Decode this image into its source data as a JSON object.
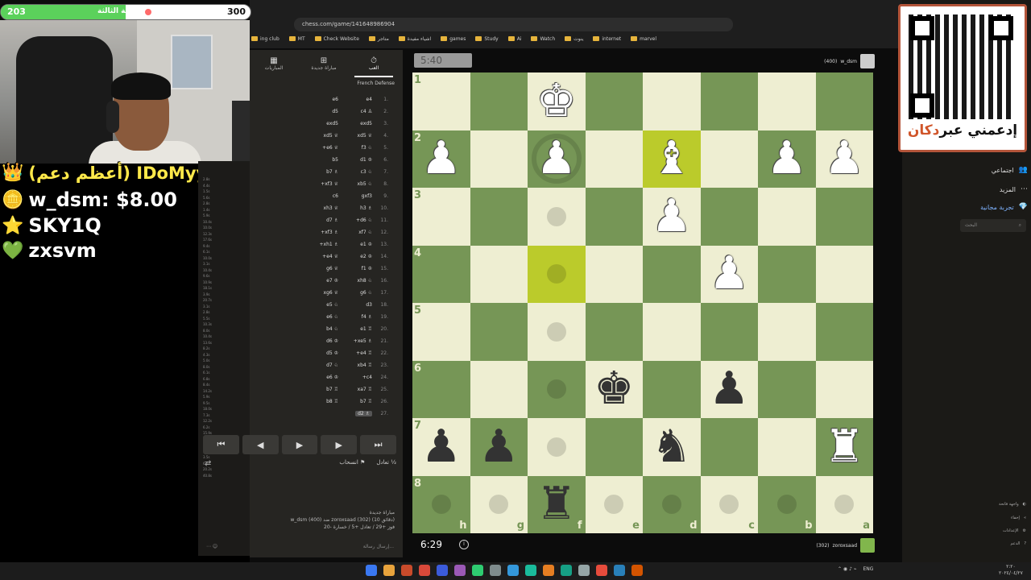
{
  "browser": {
    "url": "chess.com/game/141648986904",
    "bookmarks": [
      "ing club",
      "MT",
      "Check Website",
      "متاجر",
      "اشياء مفيدة",
      "games",
      "Study",
      "Ai",
      "Watch",
      "ينوت",
      "internet",
      "marvel"
    ]
  },
  "overlay": {
    "goal": {
      "start": "203",
      "end": "300",
      "label": "المنوية الثالثة",
      "progress_fraction": 0.5
    },
    "donations": [
      {
        "icon": "crown-icon",
        "glyph": "👑",
        "text": "(أعظم دعم) IDoMyy: $51.00"
      },
      {
        "icon": "coin-icon",
        "glyph": "🪙",
        "text": "w_dsm: $8.00"
      },
      {
        "icon": "star-icon",
        "glyph": "⭐",
        "text": "SKY1Q"
      },
      {
        "icon": "heart-icon",
        "glyph": "💚",
        "text": "zxsvm"
      }
    ]
  },
  "panel": {
    "tabs": [
      {
        "label": "العب",
        "glyph": "⏱"
      },
      {
        "label": "مباراة جديدة",
        "glyph": "⊞"
      },
      {
        "label": "المباريات",
        "glyph": "▦"
      }
    ],
    "opening": "French Defense",
    "moves": [
      {
        "n": "1.",
        "w": "e4",
        "b": "e6"
      },
      {
        "n": "2.",
        "w": "c4 ♙",
        "b": "d5"
      },
      {
        "n": "3.",
        "w": "exd5",
        "b": "exd5"
      },
      {
        "n": "4.",
        "w": "xd5 ♕",
        "b": "xd5 ♕"
      },
      {
        "n": "5.",
        "w": "f3 ♘",
        "b": "+e6 ♕"
      },
      {
        "n": "6.",
        "w": "d1 ♔",
        "b": "b5"
      },
      {
        "n": "7.",
        "w": "c3 ♘",
        "b": "b7 ♗"
      },
      {
        "n": "8.",
        "w": "xb5 ♘",
        "b": "+xf3 ♕"
      },
      {
        "n": "9.",
        "w": "gxf3",
        "b": "c6"
      },
      {
        "n": "10.",
        "w": "h3 ♗",
        "b": "xh3 ♕"
      },
      {
        "n": "11.",
        "w": "+d6 ♘",
        "b": "d7 ♗"
      },
      {
        "n": "12.",
        "w": "xf7 ♘",
        "b": "+xf3 ♗"
      },
      {
        "n": "13.",
        "w": "e1 ♔",
        "b": "+xh1 ♗"
      },
      {
        "n": "14.",
        "w": "e2 ♔",
        "b": "+e4 ♕"
      },
      {
        "n": "15.",
        "w": "f1 ♔",
        "b": "g6 ♕"
      },
      {
        "n": "16.",
        "w": "xh8 ♘",
        "b": "e7 ♔"
      },
      {
        "n": "17.",
        "w": "g6 ♘",
        "b": "xg6 ♕"
      },
      {
        "n": "18.",
        "w": "d3",
        "b": "e5 ♘"
      },
      {
        "n": "19.",
        "w": "f4 ♗",
        "b": "e6 ♘"
      },
      {
        "n": "20.",
        "w": "e1 ♖",
        "b": "b4 ♘"
      },
      {
        "n": "21.",
        "w": "+xe5 ♗",
        "b": "d6 ♔"
      },
      {
        "n": "22.",
        "w": "+e4 ♖",
        "b": "d5 ♔"
      },
      {
        "n": "23.",
        "w": "xb4 ♖",
        "b": "d7 ♘"
      },
      {
        "n": "24.",
        "w": "+c4",
        "b": "e6 ♔"
      },
      {
        "n": "25.",
        "w": "xa7 ♖",
        "b": "b7 ♖"
      },
      {
        "n": "26.",
        "w": "b7 ♖",
        "b": "b8 ♖"
      },
      {
        "n": "27.",
        "w": "d2 ♗",
        "b": ""
      }
    ],
    "move_times": [
      "2.8s",
      "4.4s",
      "1.5s",
      "5.6s",
      "2.8s",
      "1.4s",
      "5.9s",
      "10.4s",
      "10.0s",
      "12.3s",
      "17.6s",
      "9.4s",
      "6.1s",
      "10.0s",
      "3.1s",
      "10.4s",
      "9.6s",
      "10.9s",
      "18.1s",
      "3.9s",
      "20.7s",
      "3.1s",
      "2.8s",
      "5.5s",
      "10.3s",
      "8.0s",
      "10.4s",
      "13.6s",
      "8.2s",
      "4.3s",
      "5.0s",
      "8.0s",
      "6.1s",
      "6.8s",
      "8.4s",
      "14.2s",
      "5.9s",
      "9.5s",
      "18.0s",
      "7.3s",
      "12.2s",
      "6.2s",
      "15.9s",
      "32.3s",
      "15.4s",
      "15.6s",
      "3.5s",
      "6.8s",
      "20.2s",
      "40.8s"
    ],
    "nav": [
      "⏮",
      "◀",
      "▶",
      "▶",
      "⏭"
    ],
    "actions": {
      "draw": "تعادل ½",
      "resign": "انسحاب ⚑"
    },
    "game_info": [
      "مباراة جديدة",
      "w_dsm (400) ضد zoroxsaad (302) (10 دقائق)",
      "فوز +29 / تعادل +5 / خسارة -20"
    ],
    "chat_placeholder": "إرسال رسالة..."
  },
  "board": {
    "orientation": "black-bottom",
    "ranks": [
      "1",
      "2",
      "3",
      "4",
      "5",
      "6",
      "7",
      "8"
    ],
    "files": [
      "h",
      "g",
      "f",
      "e",
      "d",
      "c",
      "b",
      "a"
    ],
    "pieces": {
      "f1": "wK",
      "h2": "wP",
      "f2": "wP",
      "d2": "wB",
      "b2": "wP",
      "a2": "wP",
      "d3": "wP",
      "c4": "wP",
      "e6": "bK",
      "c6": "bP",
      "h7": "bP",
      "g7": "bP",
      "d7": "bN",
      "a7": "wR",
      "f8": "bR"
    },
    "highlight": [
      "d2",
      "f4"
    ],
    "move_dots": [
      "f3",
      "f4",
      "f5",
      "f6",
      "f7",
      "h8",
      "g8",
      "e8",
      "d8",
      "c8",
      "b8",
      "a8"
    ],
    "ring": [
      "f2"
    ]
  },
  "players": {
    "top": {
      "name": "w_dsm",
      "rating": "(400)",
      "clock": "5:40"
    },
    "bottom": {
      "name": "zoroxsaad",
      "rating": "(302)",
      "clock": "6:29"
    }
  },
  "sidebar": {
    "qr_caption_pre": "إدعمني عبر",
    "qr_caption_acc": "دكان",
    "items": [
      {
        "label": "اجتماعي",
        "icon": "people-icon",
        "glyph": "👥"
      },
      {
        "label": "المزيد",
        "icon": "more-icon",
        "glyph": "⋯"
      },
      {
        "label": "تجربة مجانية",
        "icon": "diamond-icon",
        "glyph": "💎"
      }
    ],
    "search_placeholder": "البحث",
    "small_links": [
      "واجهة فاتحة",
      "إخفاء",
      "الإعدادات",
      "الدعم"
    ]
  },
  "taskbar": {
    "lang": "ENG",
    "date": "٢٠٢٤/٠٤/٢٧",
    "time": "٢:٢٠"
  }
}
